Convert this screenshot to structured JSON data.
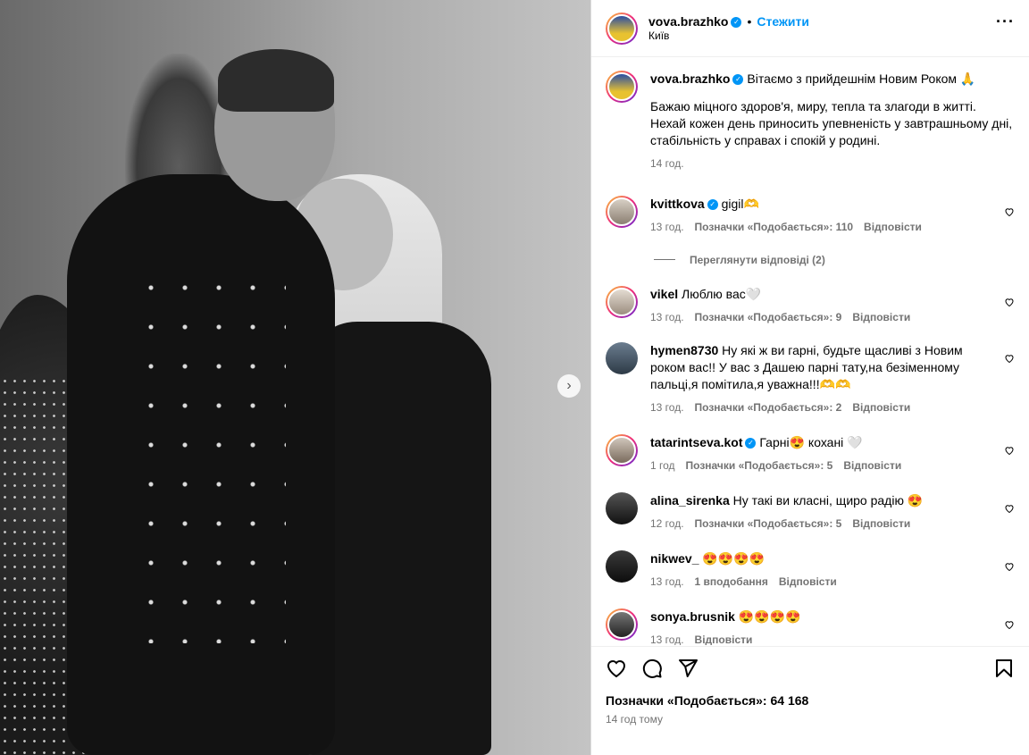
{
  "post": {
    "author": "vova.brazhko",
    "follow_label": "Стежити",
    "separator": "•",
    "location": "Київ",
    "more_icon": "more-horizontal-icon"
  },
  "caption": {
    "username": "vova.brazhko",
    "text": "Вітаємо з прийдешнім Новим Роком 🙏",
    "body": "Бажаю міцного здоров'я, миру, тепла та злагоди в житті. Нехай кожен день приносить упевненість у завтрашньому дні, стабільність у справах і спокій у родині.",
    "time": "14 год."
  },
  "comments": [
    {
      "username": "kvittkova",
      "verified": true,
      "text": "gigil🫶",
      "time": "13 год.",
      "likes": "Позначки «Подобається»: 110",
      "reply": "Відповісти"
    },
    {
      "username": "vikel",
      "verified": false,
      "text": "Люблю вас🤍",
      "time": "13 год.",
      "likes": "Позначки «Подобається»: 9",
      "reply": "Відповісти"
    },
    {
      "username": "hymen8730",
      "verified": false,
      "text": "Ну які ж ви гарні, будьте щасливі з Новим роком вас!! У вас з Дашею парні тату,на безіменному пальці,я помітила,я уважна!!!🫶🫶",
      "time": "13 год.",
      "likes": "Позначки «Подобається»: 2",
      "reply": "Відповісти"
    },
    {
      "username": "tatarintseva.kot",
      "verified": true,
      "text": "Гарні😍 кохані 🤍",
      "time": "1 год",
      "likes": "Позначки «Подобається»: 5",
      "reply": "Відповісти"
    },
    {
      "username": "alina_sirenka",
      "verified": false,
      "text": "Ну такі ви класні, щиро радію 😍",
      "time": "12 год.",
      "likes": "Позначки «Подобається»: 5",
      "reply": "Відповісти"
    },
    {
      "username": "nikwev_",
      "verified": false,
      "text": "😍😍😍😍",
      "time": "13 год.",
      "likes": "1 вподобання",
      "reply": "Відповісти"
    },
    {
      "username": "sonya.brusnik",
      "verified": false,
      "text": "😍😍😍😍",
      "time": "13 год.",
      "likes": "",
      "reply": "Відповісти"
    }
  ],
  "view_replies": "Переглянути відповіді (2)",
  "actions": {
    "likes_count": "Позначки «Подобається»: 64 168",
    "posted": "14 год тому"
  },
  "colors": {
    "accent": "#0095f6",
    "muted": "#737373"
  }
}
